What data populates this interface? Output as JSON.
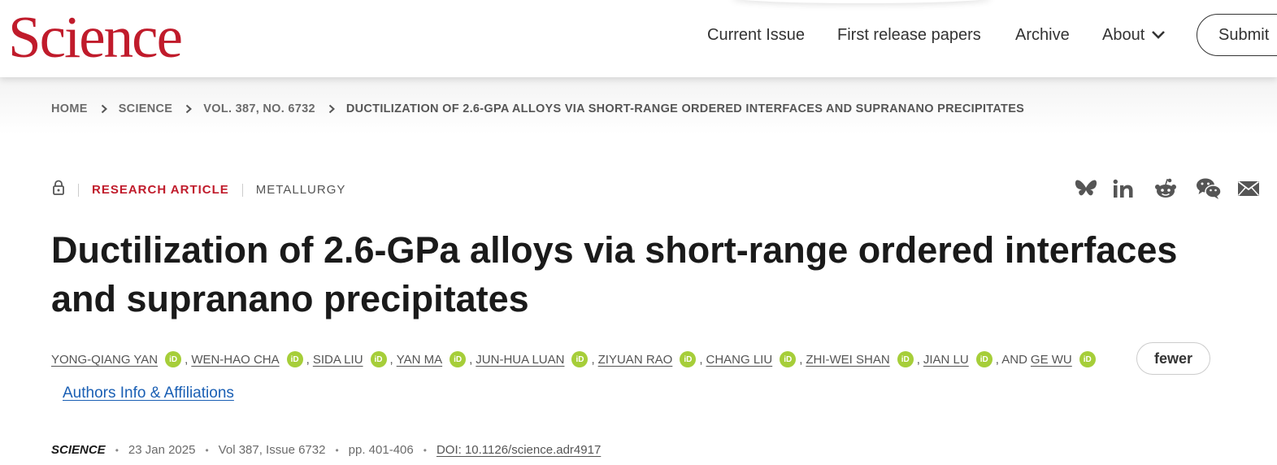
{
  "header": {
    "logo": "Science",
    "nav": [
      "Current Issue",
      "First release papers",
      "Archive",
      "About"
    ],
    "submit_label": "Submit"
  },
  "breadcrumb": {
    "items": [
      "HOME",
      "SCIENCE",
      "VOL. 387, NO. 6732"
    ],
    "current": "DUCTILIZATION OF 2.6-GPA ALLOYS VIA SHORT-RANGE ORDERED INTERFACES AND SUPRANANO PRECIPITATES"
  },
  "article": {
    "type": "RESEARCH ARTICLE",
    "subject": "METALLURGY",
    "title": "Ductilization of 2.6-GPa alloys via short-range ordered interfaces and supranano precipitates",
    "authors": [
      "YONG-QIANG YAN",
      "WEN-HAO CHA",
      "SIDA LIU",
      "YAN MA",
      "JUN-HUA LUAN",
      "ZIYUAN RAO",
      "CHANG LIU",
      "ZHI-WEI SHAN",
      "JIAN LU",
      "GE WU"
    ],
    "author_separator": ",",
    "and_label": ", AND",
    "fewer_label": "fewer",
    "affiliations_label": "Authors Info & Affiliations"
  },
  "citation": {
    "journal": "SCIENCE",
    "date": "23 Jan 2025",
    "volume": "Vol 387, Issue 6732",
    "pages": "pp. 401-406",
    "doi": "DOI: 10.1126/science.adr4917"
  },
  "icons": {
    "lock": "lock-icon",
    "share": [
      "bluesky-icon",
      "linkedin-icon",
      "reddit-icon",
      "wechat-icon",
      "email-icon"
    ],
    "orcid": "orcid-icon"
  },
  "colors": {
    "brand_red": "#c01b2b",
    "orcid_green": "#a6ce39",
    "link_blue": "#1a5fb4"
  }
}
